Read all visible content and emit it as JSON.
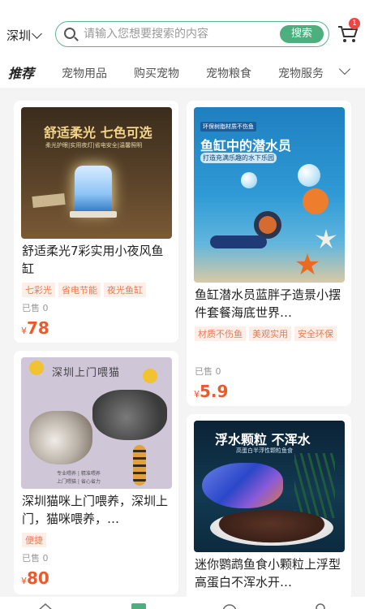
{
  "header": {
    "city": "深圳",
    "search_placeholder": "请输入您想要搜索的内容",
    "search_button": "搜索",
    "cart_badge": "1"
  },
  "categories": {
    "active": "推荐",
    "items": [
      "宠物用品",
      "购买宠物",
      "宠物粮食",
      "宠物服务"
    ]
  },
  "products": [
    {
      "image_text": [
        "舒适柔光 七色可选",
        "柔光护眼|实用夜灯|省电安全|温馨照明"
      ],
      "title": "舒适柔光7彩实用小夜风鱼缸",
      "tags": [
        "七彩光",
        "省电节能",
        "夜光鱼缸"
      ],
      "sold": "已售 0",
      "price_symbol": "¥",
      "price": "78"
    },
    {
      "image_text": [
        "环保树脂材质不伤鱼",
        "鱼缸中的潜水员",
        "打造充满乐趣的水下乐园"
      ],
      "title": "鱼缸潜水员蓝胖子造景小摆件套餐海底世界…",
      "tags": [
        "材质不伤鱼",
        "美观实用",
        "安全环保"
      ],
      "sold": "已售 0",
      "price_symbol": "¥",
      "price": "5.9"
    },
    {
      "image_text": [
        "深圳上门喂猫",
        "专业喂养 | 精准喂养",
        "上门喂猫 | 省心省力"
      ],
      "title": "深圳猫咪上门喂养，深圳上门，猫咪喂养，…",
      "tags": [
        "便捷"
      ],
      "sold": "已售 0",
      "price_symbol": "¥",
      "price": "80"
    },
    {
      "image_text": [
        "浮水颗粒 不浑水",
        "高蛋白半浮性颗粒鱼食"
      ],
      "title": "迷你鹦鹉鱼食小颗粒上浮型高蛋白不浑水开…",
      "tags": [],
      "sold": "",
      "price_symbol": "",
      "price": ""
    }
  ],
  "colors": {
    "brand_green": "#4caf7d",
    "price_orange": "#ec5a2c",
    "tag_text": "#e87a53",
    "tag_bg": "#fdeee7"
  }
}
